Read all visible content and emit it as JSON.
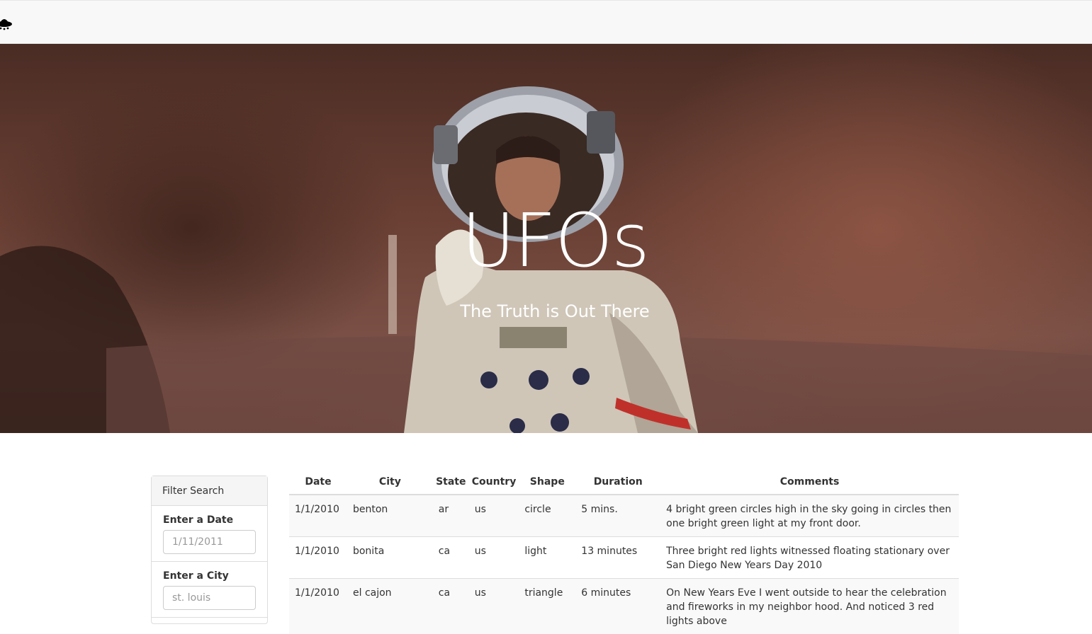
{
  "navbar": {
    "logo": "ufo-icon"
  },
  "hero": {
    "title": "UFOs",
    "subtitle": "The Truth is Out There"
  },
  "filters": {
    "heading": "Filter Search",
    "date": {
      "label": "Enter a Date",
      "placeholder": "1/11/2011",
      "value": ""
    },
    "city": {
      "label": "Enter a City",
      "placeholder": "st. louis",
      "value": ""
    }
  },
  "table": {
    "headers": [
      "Date",
      "City",
      "State",
      "Country",
      "Shape",
      "Duration",
      "Comments"
    ],
    "rows": [
      [
        "1/1/2010",
        "benton",
        "ar",
        "us",
        "circle",
        "5 mins.",
        "4 bright green circles high in the sky going in circles then one bright green light at my front door."
      ],
      [
        "1/1/2010",
        "bonita",
        "ca",
        "us",
        "light",
        "13 minutes",
        "Three bright red lights witnessed floating stationary over San Diego New Years Day 2010"
      ],
      [
        "1/1/2010",
        "el cajon",
        "ca",
        "us",
        "triangle",
        "6 minutes",
        "On New Years Eve I went outside to hear the celebration and fireworks in my neighbor hood. And noticed 3 red lights above"
      ]
    ]
  }
}
